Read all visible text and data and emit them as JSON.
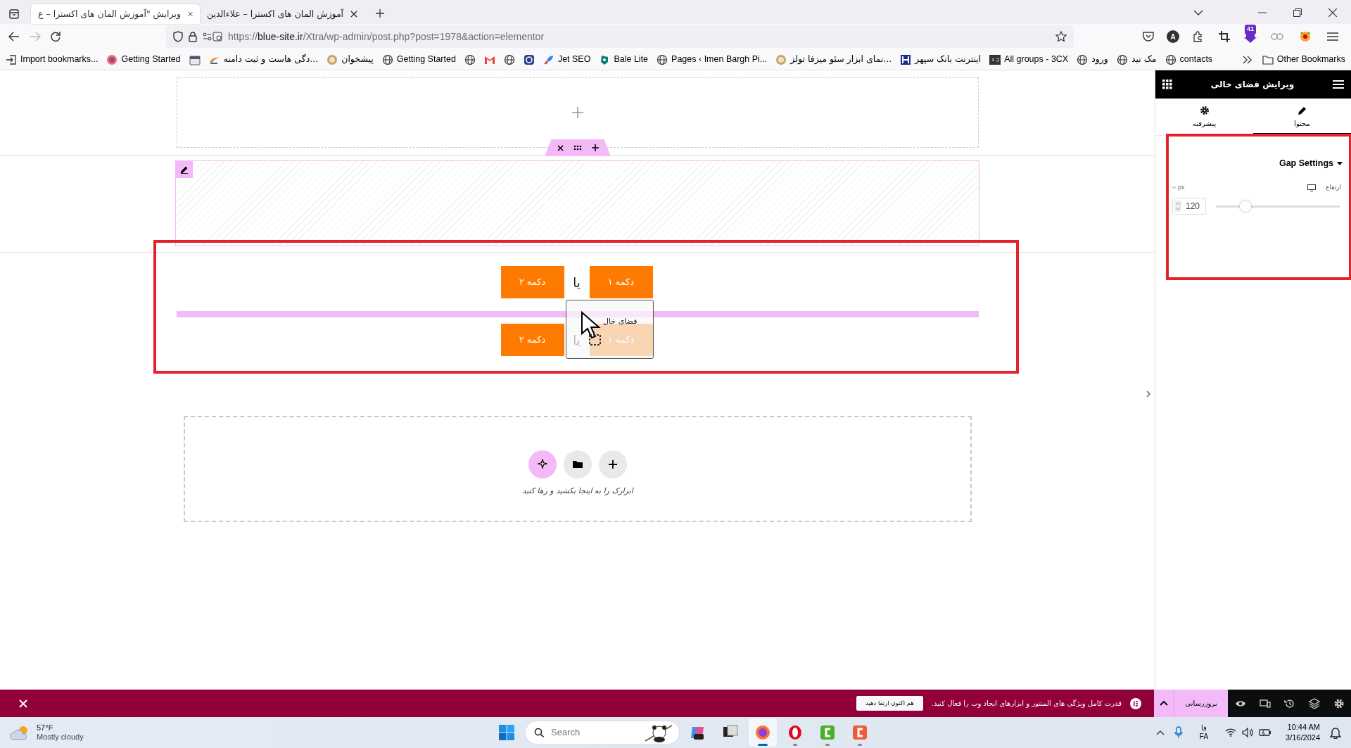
{
  "browser": {
    "tabs": [
      {
        "title": "آموزش المان های اکسترا – علاءالدین",
        "selected": false
      },
      {
        "title": "ویرایش \"آموزش المان های اکسترا – ع",
        "selected": true
      }
    ],
    "address": {
      "scheme": "https://",
      "host": "blue-site.ir",
      "path": "/Xtra/wp-admin/post.php?post=1978&action=elementor"
    },
    "account_initial": "A",
    "extension_badge": "41",
    "bookmarks": [
      {
        "kind": "globe",
        "label": "contacts"
      },
      {
        "kind": "globe",
        "label": "مک نید"
      },
      {
        "kind": "globe",
        "label": "ورود"
      },
      {
        "kind": "cx",
        "label": "All groups - 3CX"
      },
      {
        "kind": "bank",
        "label": "اینترنت بانک سپهر"
      },
      {
        "kind": "lion",
        "label": "...نمای ابزار سئو میزفا تولز"
      },
      {
        "kind": "globe",
        "label": "Pages ‹ Imen Bargh Pi..."
      },
      {
        "kind": "bale",
        "label": "Bale Lite"
      },
      {
        "kind": "rocket",
        "label": "Jet SEO"
      },
      {
        "kind": "wp"
      },
      {
        "kind": "globe"
      },
      {
        "kind": "gmail"
      },
      {
        "kind": "globe"
      },
      {
        "kind": "globe",
        "label": "Getting Started"
      },
      {
        "kind": "lion",
        "label": "پیشخوان"
      },
      {
        "kind": "swoosh",
        "label": "...دگی هاست و ثبت دامنه"
      },
      {
        "kind": "calendar"
      },
      {
        "kind": "firefox",
        "label": "Getting Started"
      },
      {
        "kind": "import",
        "label": "Import bookmarks..."
      }
    ],
    "other_bookmarks": "Other Bookmarks"
  },
  "canvas": {
    "button_rows": [
      {
        "buttons": [
          "دکمه ۱",
          "دکمه ۲"
        ],
        "separator": "یا"
      },
      {
        "buttons": [
          "دکمه ۱",
          "دکمه ۲"
        ],
        "separator": "یا"
      }
    ],
    "drag_ghost": "فضای خال",
    "drop_hint": "ابزارک را به اینجا بکشید و رها کنید"
  },
  "panel": {
    "title": "ویرایش فضای خالی",
    "tabs": [
      {
        "kind": "content",
        "label": "محتوا",
        "selected": true
      },
      {
        "kind": "advanced",
        "label": "پیشرفته",
        "selected": false
      }
    ],
    "section": {
      "title": "Gap Settings",
      "expanded": true
    },
    "control": {
      "label": "ارتفاع",
      "unit": "px",
      "value": "120",
      "level": 0.24
    }
  },
  "notice_bar": {
    "notice": "قدرت کامل ویژگی های المنتور و ابزارهای ایجاد وب را فعال کنید.",
    "upgrade_button": "هم اکنون ارتقا دهید",
    "update_button": "بروزرسانی"
  },
  "taskbar": {
    "temperature": "57°F",
    "weather": "Mostly cloudy",
    "search_placeholder": "Search",
    "apps": [
      {
        "kind": "copilot",
        "selected": false
      },
      {
        "kind": "taskview",
        "selected": false
      },
      {
        "kind": "firefox",
        "selected": true
      },
      {
        "kind": "opera",
        "selected": false
      },
      {
        "kind": "camtasia",
        "selected": false
      },
      {
        "kind": "recorder",
        "selected": false
      }
    ],
    "language": [
      "فا",
      "FA"
    ],
    "time": "10:44 AM",
    "date": "3/16/2024"
  }
}
